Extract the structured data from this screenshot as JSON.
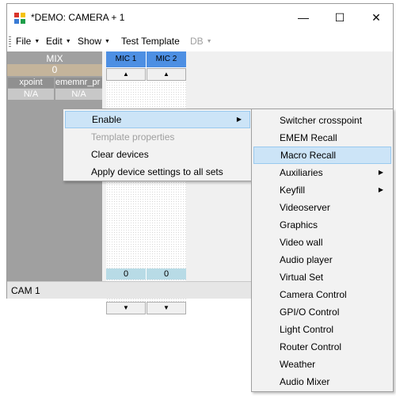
{
  "window": {
    "title": "*DEMO: CAMERA + 1",
    "minimize": "—",
    "maximize": "☐",
    "close": "✕"
  },
  "menu": {
    "file": "File",
    "edit": "Edit",
    "show": "Show",
    "test_template": "Test Template",
    "db": "DB"
  },
  "left_panel": {
    "header": "MIX",
    "value": "0",
    "col1": "xpoint",
    "col2": "ememnr_pr",
    "val1": "N/A",
    "val2": "N/A"
  },
  "matrix": {
    "columns": [
      "MIC 1",
      "MIC 2"
    ],
    "values": [
      "0",
      "0"
    ]
  },
  "status": "CAM 1",
  "context_menu": {
    "items": [
      {
        "label": "Enable",
        "state": "highlighted",
        "submenu": true
      },
      {
        "label": "Template properties",
        "state": "disabled"
      },
      {
        "label": "Clear devices",
        "state": "normal"
      },
      {
        "label": "Apply device settings to all sets",
        "state": "normal"
      }
    ]
  },
  "submenu": {
    "items": [
      {
        "label": "Switcher crosspoint"
      },
      {
        "label": "EMEM Recall"
      },
      {
        "label": "Macro Recall",
        "highlighted": true
      },
      {
        "label": "Auxiliaries",
        "submenu": true
      },
      {
        "label": "Keyfill",
        "submenu": true
      },
      {
        "label": "Videoserver"
      },
      {
        "label": "Graphics"
      },
      {
        "label": "Video wall"
      },
      {
        "label": "Audio player"
      },
      {
        "label": "Virtual Set"
      },
      {
        "label": "Camera Control"
      },
      {
        "label": "GPI/O Control"
      },
      {
        "label": "Light Control"
      },
      {
        "label": "Router Control"
      },
      {
        "label": "Weather"
      },
      {
        "label": "Audio Mixer"
      }
    ]
  },
  "colors": {
    "highlight": "#cce4f7",
    "column_header": "#4d8fe3",
    "panel_gray": "#a0a0a0",
    "value_cell": "#b8dbe6"
  }
}
